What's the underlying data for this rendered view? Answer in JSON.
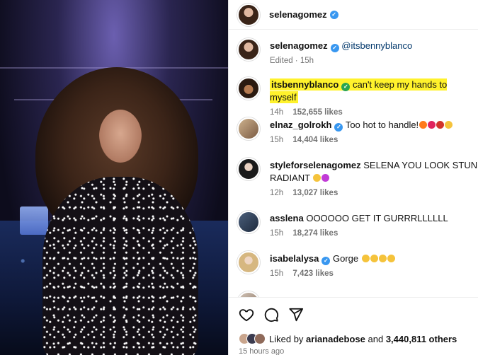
{
  "post": {
    "author": "selenagomez",
    "caption_mention": "@itsbennyblanco",
    "edited_label": "Edited",
    "edited_time": "15h",
    "time_ago": "15 hours ago"
  },
  "comments": [
    {
      "username": "itsbennyblanco",
      "verified": true,
      "text": "can't keep my hands to myself",
      "time": "14h",
      "likes": "152,655 likes",
      "highlighted": true
    },
    {
      "username": "elnaz_golrokh",
      "verified": true,
      "text": "Too hot to handle!",
      "emojis": [
        "fire-emoji",
        "red-heart-emoji",
        "hot-pepper-emoji",
        "face-emoji"
      ],
      "time": "15h",
      "likes": "14,404 likes"
    },
    {
      "username": "styleforselenagomez",
      "verified": false,
      "text": "SELENA YOU LOOK STUNNIN",
      "text_line2": "RADIANT",
      "emojis": [
        "hands-emoji",
        "purple-heart-emoji"
      ],
      "time": "12h",
      "likes": "13,027 likes"
    },
    {
      "username": "asslena",
      "verified": false,
      "text": "OOOOOO GET IT GURRRLLLLLL",
      "time": "15h",
      "likes": "18,274 likes"
    },
    {
      "username": "isabelalysa",
      "verified": true,
      "text": "Gorge",
      "emojis": [
        "heart-eyes-emoji",
        "heart-eyes-emoji",
        "heart-eyes-emoji",
        "heart-eyes-emoji"
      ],
      "time": "15h",
      "likes": "7,423 likes"
    }
  ],
  "likes": {
    "prefix": "Liked by",
    "user": "arianadebose",
    "joiner": "and",
    "count": "3,440,811 others"
  },
  "icons": [
    "heart-icon",
    "comment-icon",
    "share-icon"
  ],
  "colors": {
    "highlight": "#fff22c",
    "verified": "#3897f0",
    "link": "#00376b"
  }
}
